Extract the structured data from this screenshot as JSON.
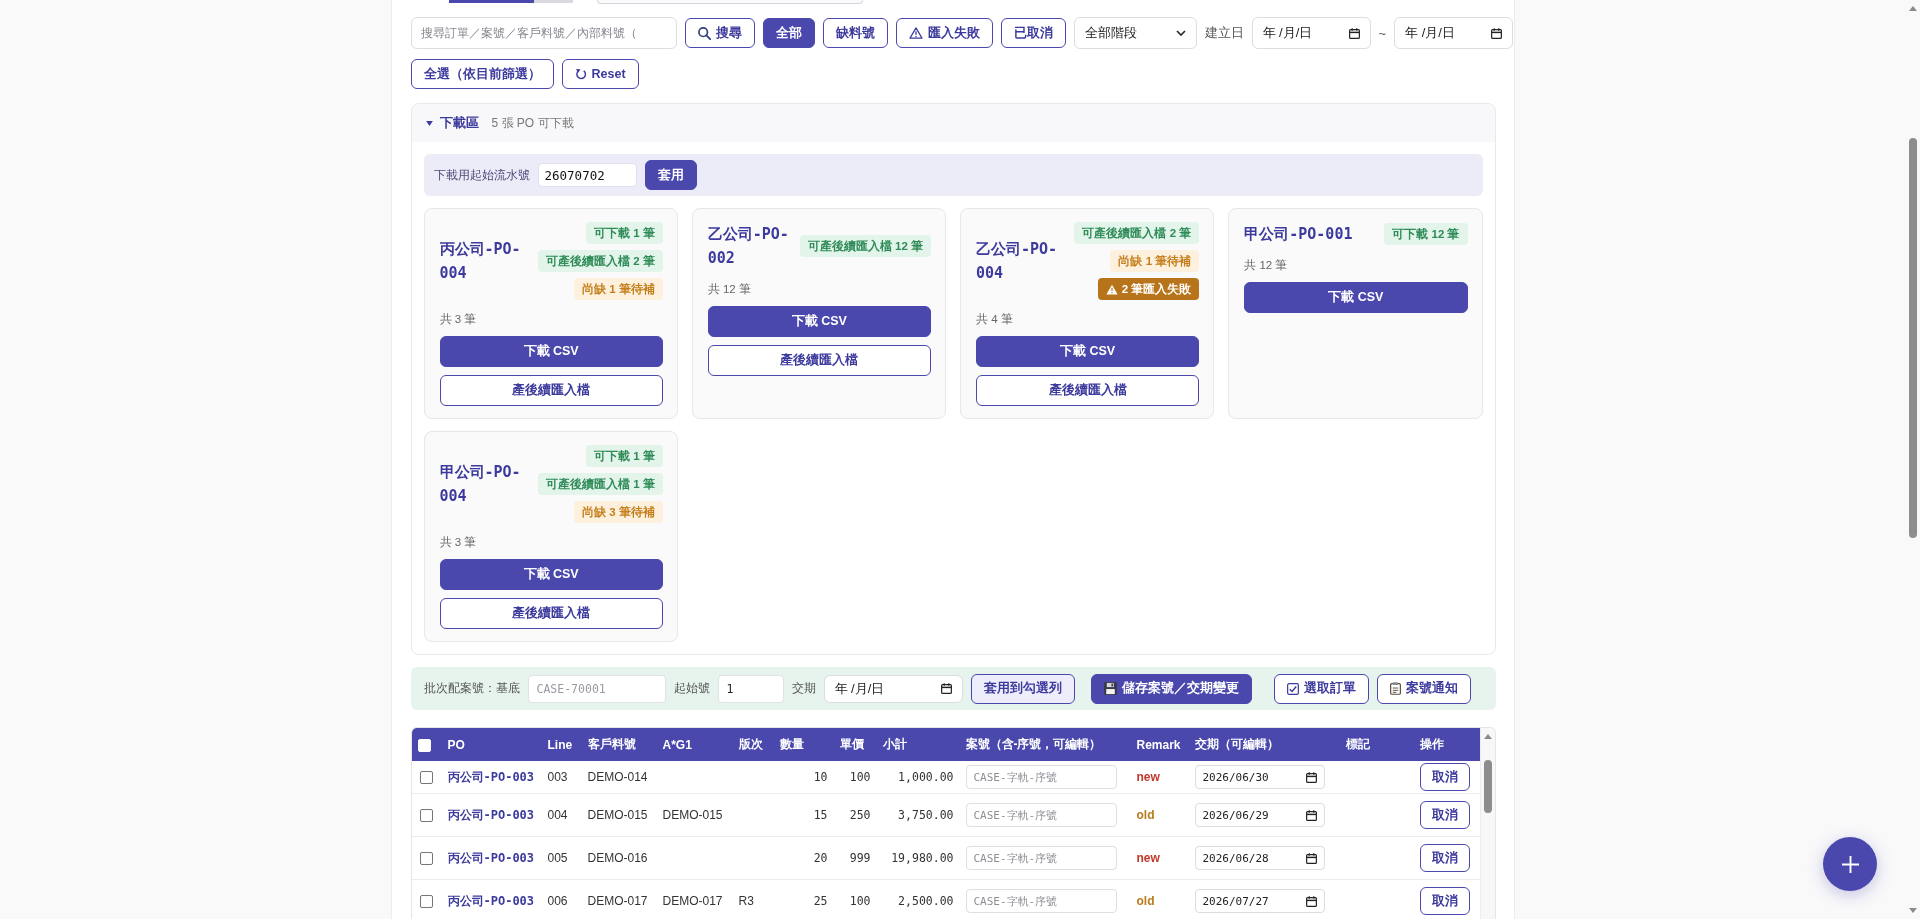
{
  "filters": {
    "search": {
      "placeholder": "搜尋訂單／案號／客戶料號／內部料號（"
    },
    "search_button": "搜尋",
    "chips": [
      {
        "label": "全部",
        "kind": "plain",
        "selected": true
      },
      {
        "label": "缺料號",
        "kind": "plain",
        "selected": false
      },
      {
        "label": "匯入失敗",
        "kind": "warning",
        "selected": false
      },
      {
        "label": "已取消",
        "kind": "plain",
        "selected": false
      }
    ],
    "stage_select": "全部階段",
    "date_label": "建立日",
    "date_from": {
      "placeholder": "年 /月/日"
    },
    "range_separator": "~",
    "date_to": {
      "placeholder": "年 /月/日"
    },
    "select_all_button": "全選（依目前篩選）",
    "reset_button": "Reset"
  },
  "download_panel": {
    "title": "下載區",
    "expanded": true,
    "summary": "5 張 PO 可下載",
    "serial": {
      "label": "下載用起始流水號",
      "value": "26070702",
      "button": "套用"
    },
    "cards": [
      {
        "title": "丙公司-PO-004",
        "badges": [
          {
            "kind": "ok",
            "text": "可下載 1 筆"
          },
          {
            "kind": "ok",
            "text": "可產後續匯入檔 2 筆"
          },
          {
            "kind": "missing",
            "text": "尚缺 1 筆待補"
          }
        ],
        "count": "共 3 筆",
        "buttons": [
          {
            "kind": "primary",
            "label": "下載 CSV"
          },
          {
            "kind": "outline",
            "label": "產後續匯入檔"
          }
        ]
      },
      {
        "title": "乙公司-PO-002",
        "badges": [
          {
            "kind": "ok",
            "text": "可產後續匯入檔 12 筆"
          }
        ],
        "count": "共 12 筆",
        "buttons": [
          {
            "kind": "primary",
            "label": "下載 CSV"
          },
          {
            "kind": "outline",
            "label": "產後續匯入檔"
          }
        ]
      },
      {
        "title": "乙公司-PO-004",
        "badges": [
          {
            "kind": "ok",
            "text": "可產後續匯入檔 2 筆"
          },
          {
            "kind": "missing",
            "text": "尚缺 1 筆待補"
          },
          {
            "kind": "error",
            "text": "2 筆匯入失敗"
          }
        ],
        "count": "共 4 筆",
        "buttons": [
          {
            "kind": "primary",
            "label": "下載 CSV"
          },
          {
            "kind": "outline",
            "label": "產後續匯入檔"
          }
        ]
      },
      {
        "title": "甲公司-PO-001",
        "badges": [
          {
            "kind": "ok",
            "text": "可下載 12 筆"
          }
        ],
        "count": "共 12 筆",
        "buttons": [
          {
            "kind": "primary",
            "label": "下載 CSV"
          }
        ]
      },
      {
        "title": "甲公司-PO-004",
        "badges": [
          {
            "kind": "ok",
            "text": "可下載 1 筆"
          },
          {
            "kind": "ok",
            "text": "可產後續匯入檔 1 筆"
          },
          {
            "kind": "missing",
            "text": "尚缺 3 筆待補"
          }
        ],
        "count": "共 3 筆",
        "buttons": [
          {
            "kind": "primary",
            "label": "下載 CSV"
          },
          {
            "kind": "outline",
            "label": "產後續匯入檔"
          }
        ]
      }
    ]
  },
  "batch_bar": {
    "label": "批次配案號：基底",
    "base": {
      "placeholder": "CASE-70001"
    },
    "start_label": "起始號",
    "start": {
      "value": "1"
    },
    "due_label": "交期",
    "due": {
      "placeholder": "年 /月/日"
    },
    "buttons": [
      {
        "kind": "apply",
        "label": "套用到勾選列"
      },
      {
        "kind": "save",
        "label": "儲存案號／交期變更"
      },
      {
        "kind": "select",
        "label": "選取訂單"
      },
      {
        "kind": "notify",
        "label": "案號通知"
      }
    ]
  },
  "table": {
    "select_all_checked": false,
    "columns": [
      "PO",
      "Line",
      "客戶料號",
      "A*G1",
      "版次",
      "數量",
      "單價",
      "小計",
      "案號（含-序號，可編輯）",
      "Remark",
      "交期（可編輯）",
      "標記",
      "操作"
    ],
    "rows": [
      {
        "checked": false,
        "po": "丙公司-PO-003",
        "line": "003",
        "customer_part": "DEMO-014",
        "qty": "10",
        "price": "100",
        "subtotal": "1,000.00",
        "case": {
          "placeholder": "CASE-字軌-序號"
        },
        "remark": {
          "text": "new",
          "color": "#c0392b"
        },
        "due": "2026/06/30",
        "action": "取消"
      },
      {
        "checked": false,
        "po": "丙公司-PO-003",
        "line": "004",
        "customer_part": "DEMO-015",
        "ag1": "DEMO-015",
        "qty": "15",
        "price": "250",
        "subtotal": "3,750.00",
        "case": {
          "placeholder": "CASE-字軌-序號"
        },
        "remark": {
          "text": "old",
          "color": "#b97a1c"
        },
        "due": "2026/06/29",
        "action": "取消"
      },
      {
        "checked": false,
        "po": "丙公司-PO-003",
        "line": "005",
        "customer_part": "DEMO-016",
        "qty": "20",
        "price": "999",
        "subtotal": "19,980.00",
        "case": {
          "placeholder": "CASE-字軌-序號"
        },
        "remark": {
          "text": "new",
          "color": "#c0392b"
        },
        "due": "2026/06/28",
        "action": "取消"
      },
      {
        "checked": false,
        "po": "丙公司-PO-003",
        "line": "006",
        "customer_part": "DEMO-017",
        "ag1": "DEMO-017",
        "rev": "R3",
        "qty": "25",
        "price": "100",
        "subtotal": "2,500.00",
        "case": {
          "placeholder": "CASE-字軌-序號"
        },
        "remark": {
          "text": "old",
          "color": "#b97a1c"
        },
        "due": "2026/07/27",
        "action": "取消"
      }
    ]
  }
}
